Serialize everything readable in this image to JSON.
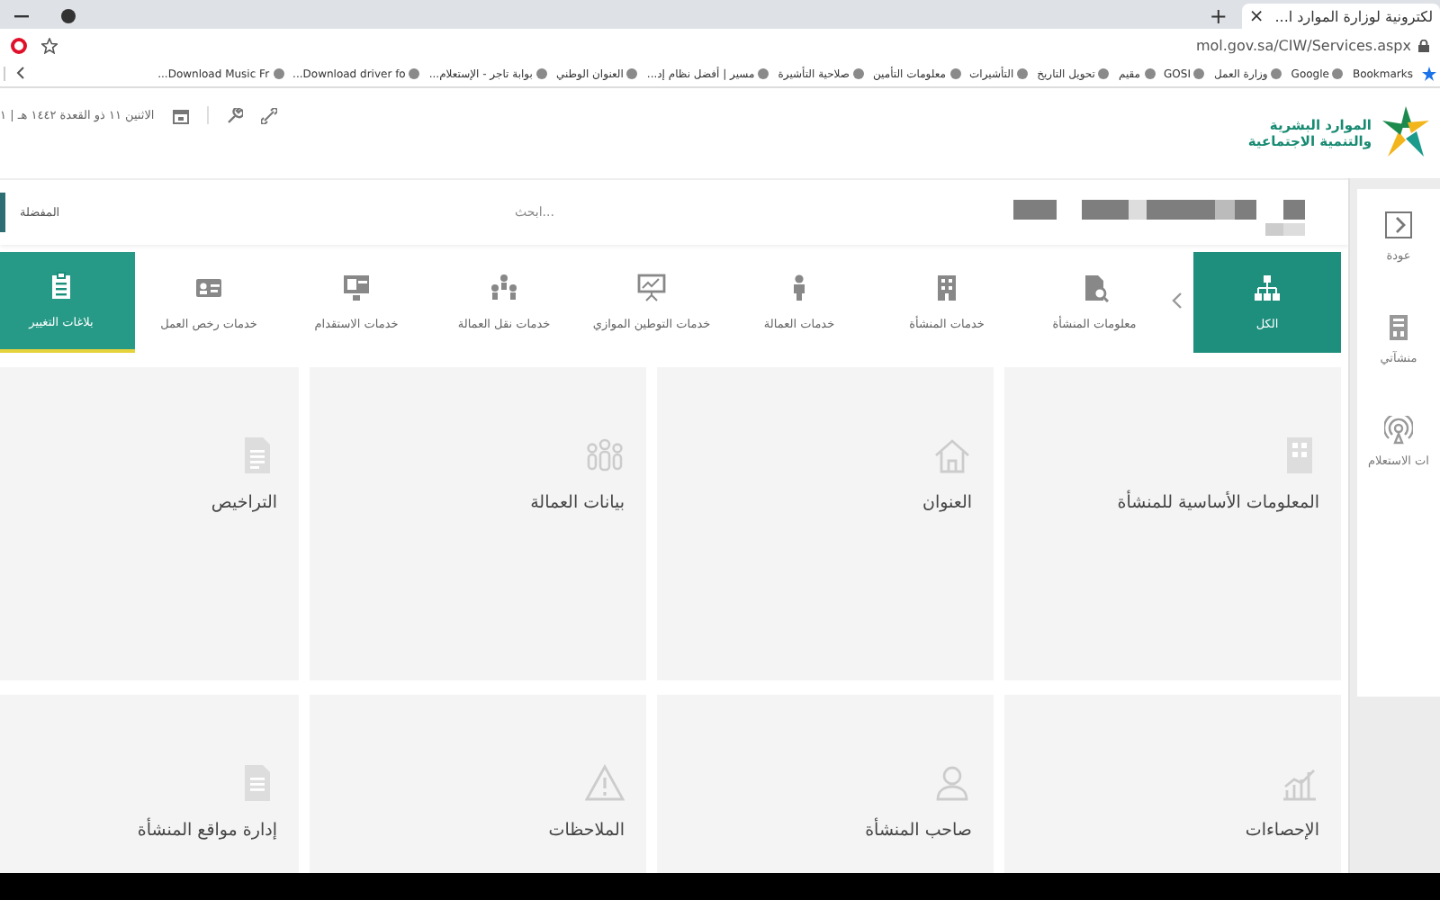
{
  "browser": {
    "tab_title": "لكترونية لوزارة الموارد ا...",
    "tab_close": "×",
    "new_tab": "+",
    "address": "mol.gov.sa/CIW/Services.aspx",
    "bookmarks": [
      "Bookmarks",
      "Google",
      "وزارة العمل",
      "GOSI",
      "مقيم",
      "تحويل التاريخ",
      "التأشيرات",
      "معلومات التأمين",
      "صلاحية التأشيرة",
      "مسير | أفضل نظام إد...",
      "العنوان الوطني",
      "بوابة تاجر - الإستعلام...",
      "Download driver fo...",
      "Download Music Fr..."
    ]
  },
  "header": {
    "logo_line1": "الموارد البشرية",
    "logo_line2": "والتنمية الاجتماعية",
    "date": "الاثنين ١١ ذو القعدة ١٤٤٢ هـ | ١"
  },
  "search": {
    "favorites_label": "المفضلة",
    "placeholder": "ابحث..."
  },
  "service_tabs": [
    {
      "label": "الكل",
      "selected": true,
      "hovered": false
    },
    {
      "label": "معلومات المنشأة",
      "selected": false,
      "hovered": false
    },
    {
      "label": "خدمات المنشأة",
      "selected": false,
      "hovered": false
    },
    {
      "label": "خدمات العمالة",
      "selected": false,
      "hovered": false
    },
    {
      "label": "خدمات التوطين الموازي",
      "selected": false,
      "hovered": false
    },
    {
      "label": "خدمات نقل العمالة",
      "selected": false,
      "hovered": false
    },
    {
      "label": "خدمات الاستقدام",
      "selected": false,
      "hovered": false
    },
    {
      "label": "خدمات رخص العمل",
      "selected": false,
      "hovered": false
    },
    {
      "label": "بلاغات التغيير",
      "selected": false,
      "hovered": true
    }
  ],
  "sidebar": [
    {
      "label": "عودة"
    },
    {
      "label": "منشآتي"
    },
    {
      "label": "ات الاستعلام"
    }
  ],
  "cards": [
    {
      "title": "المعلومات الأساسية للمنشأة"
    },
    {
      "title": "العنوان"
    },
    {
      "title": "بيانات العمالة"
    },
    {
      "title": "التراخيص"
    },
    {
      "title": "الإحصاءات"
    },
    {
      "title": "صاحب المنشأة"
    },
    {
      "title": "الملاحظات"
    },
    {
      "title": "إدارة مواقع المنشأة"
    }
  ]
}
